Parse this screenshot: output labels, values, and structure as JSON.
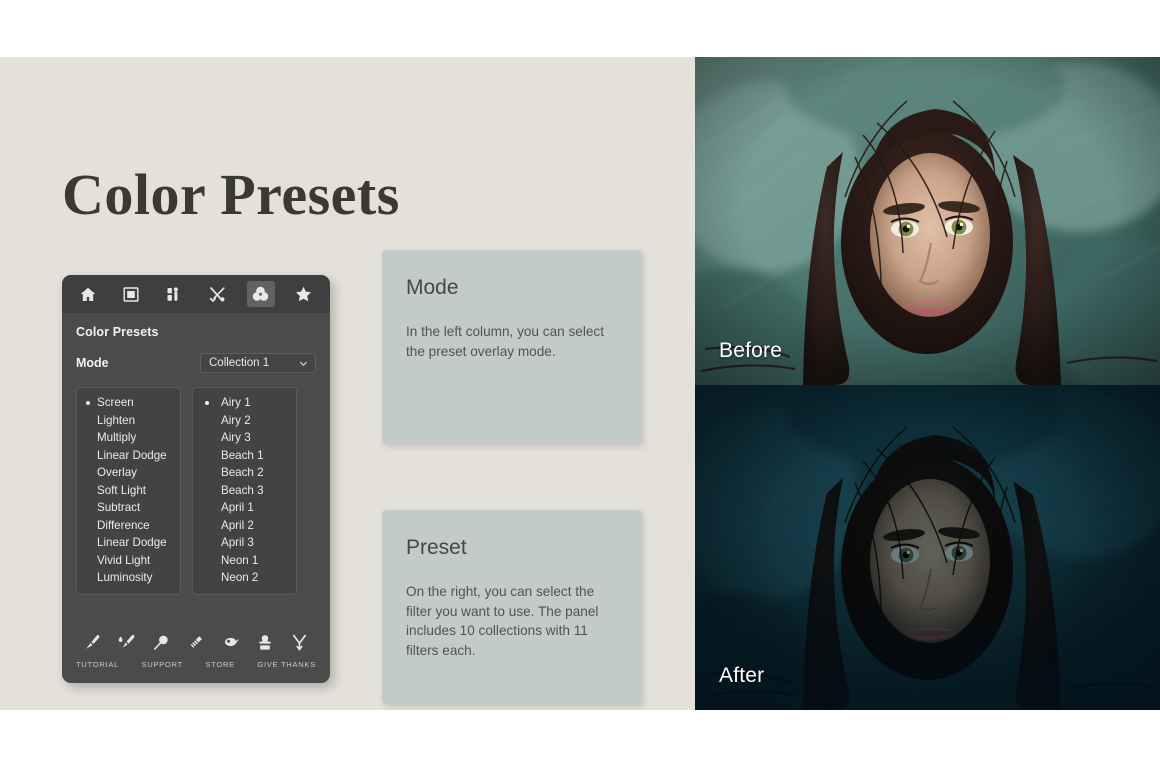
{
  "page": {
    "title": "Color Presets",
    "background_color": "#e4e0da",
    "title_color": "#3b3a31"
  },
  "panel": {
    "heading": "Color Presets",
    "toolbar_icons": [
      {
        "name": "home-icon",
        "active": false
      },
      {
        "name": "frame-icon",
        "active": false
      },
      {
        "name": "sliders-icon",
        "active": false
      },
      {
        "name": "tools-icon",
        "active": false
      },
      {
        "name": "color-circles-icon",
        "active": true
      },
      {
        "name": "star-icon",
        "active": false
      }
    ],
    "mode": {
      "label": "Mode",
      "dropdown_value": "Collection 1"
    },
    "mode_list": {
      "selected": "Screen",
      "items": [
        "Screen",
        "Lighten",
        "Multiply",
        "Linear Dodge",
        "Overlay",
        "Soft Light",
        "Subtract",
        "Difference",
        "Linear Dodge",
        "Vivid Light",
        "Luminosity"
      ]
    },
    "preset_list": {
      "selected": "Airy 1",
      "items": [
        "Airy 1",
        "Airy 2",
        "Airy 3",
        "Beach 1",
        "Beach 2",
        "Beach 3",
        "April 1",
        "April 2",
        "April 3",
        "Neon 1",
        "Neon 2"
      ]
    },
    "footer": {
      "icons": [
        {
          "name": "brush-icon"
        },
        {
          "name": "mixer-brush-icon"
        },
        {
          "name": "magnifier-icon"
        },
        {
          "name": "eraser-icon"
        },
        {
          "name": "dodge-icon"
        },
        {
          "name": "stamp-icon"
        },
        {
          "name": "wishbone-icon"
        }
      ],
      "labels": [
        "TUTORIAL",
        "SUPPORT",
        "STORE",
        "GIVE THANKS"
      ]
    }
  },
  "cards": [
    {
      "id": "mode",
      "title": "Mode",
      "body": "In the left column, you can select the preset overlay mode."
    },
    {
      "id": "preset",
      "title": "Preset",
      "body": "On the right, you can select the filter you want to use. The panel includes 10 collections with 11 filters each."
    }
  ],
  "photos": {
    "before_label": "Before",
    "after_label": "After"
  }
}
